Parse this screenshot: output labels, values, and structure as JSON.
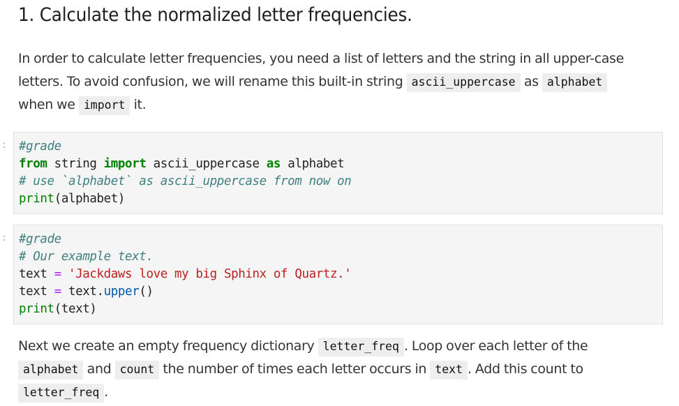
{
  "heading": "1. Calculate the normalized letter frequencies.",
  "para1": {
    "line1": "In order to calculate letter frequencies, you need a list of letters and the string in all upper-case",
    "line2_a": "letters. To avoid confusion, we will rename this built-in string ",
    "line2_code1": "ascii_uppercase",
    "line2_b": " as ",
    "line2_code2": "alphabet",
    "line3_a": "when we ",
    "line3_code": "import",
    "line3_b": " it."
  },
  "cells": [
    {
      "prompt": ":",
      "lines": [
        [
          {
            "t": "#grade",
            "k": "c1"
          }
        ],
        [
          {
            "t": "from",
            "k": "kw"
          },
          {
            "t": " string ",
            "k": ""
          },
          {
            "t": "import",
            "k": "kw"
          },
          {
            "t": " ascii_uppercase ",
            "k": ""
          },
          {
            "t": "as",
            "k": "kw"
          },
          {
            "t": " alphabet",
            "k": ""
          }
        ],
        [
          {
            "t": "# use `alphabet` as ascii_uppercase from now on",
            "k": "c1"
          }
        ],
        [
          {
            "t": "print",
            "k": "bi"
          },
          {
            "t": "(alphabet)",
            "k": ""
          }
        ]
      ]
    },
    {
      "prompt": ":",
      "lines": [
        [
          {
            "t": "#grade",
            "k": "c1"
          }
        ],
        [
          {
            "t": "# Our example text.",
            "k": "c1"
          }
        ],
        [
          {
            "t": "text ",
            "k": ""
          },
          {
            "t": "=",
            "k": "op"
          },
          {
            "t": " ",
            "k": ""
          },
          {
            "t": "'Jackdaws love my big Sphinx of Quartz.'",
            "k": "st"
          }
        ],
        [
          {
            "t": "text ",
            "k": ""
          },
          {
            "t": "=",
            "k": "op"
          },
          {
            "t": " text.",
            "k": ""
          },
          {
            "t": "upper",
            "k": "mt"
          },
          {
            "t": "()",
            "k": ""
          }
        ],
        [
          {
            "t": "print",
            "k": "bi"
          },
          {
            "t": "(text)",
            "k": ""
          }
        ]
      ]
    }
  ],
  "para2": {
    "line1_a": "Next we create an empty frequency dictionary ",
    "line1_code": "letter_freq",
    "line1_b": ". Loop over each letter of the",
    "line2_code1": "alphabet",
    "line2_a": " and ",
    "line2_code2": "count",
    "line2_b": " the number of times each letter occurs in ",
    "line2_code3": "text",
    "line2_c": ". Add this count to",
    "line3_code": "letter_freq",
    "line3_b": "."
  },
  "colors": {
    "comment": "#408080",
    "keyword": "#008000",
    "builtin": "#008000",
    "operator": "#aa22ff",
    "string": "#ba2121",
    "method": "#0055aa",
    "inline_code_bg": "#eeeeee",
    "code_cell_bg": "#f5f5f5"
  }
}
